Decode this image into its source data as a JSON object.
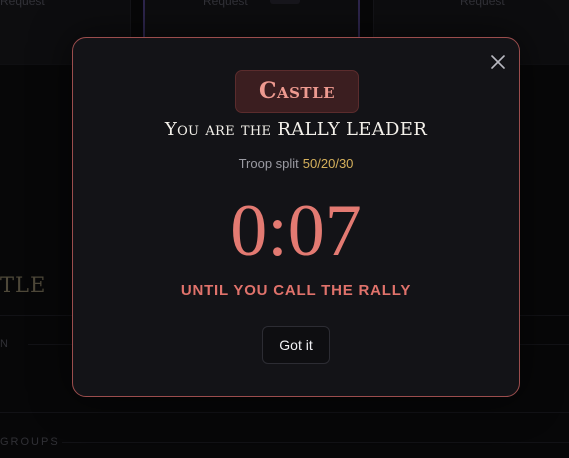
{
  "background": {
    "card_captions": [
      "Request",
      "Request",
      "Request"
    ],
    "section_title": "CASTLE",
    "section_title_visible": "TLE",
    "label_one": "N",
    "label_two": "GROUPS"
  },
  "modal": {
    "badge": "Castle",
    "headline": "You are the RALLY LEADER",
    "split_label": "Troop split",
    "split_value": "50/20/30",
    "timer": "0:07",
    "until_text": "UNTIL YOU CALL THE RALLY",
    "button_label": "Got it",
    "close_icon": "close-icon"
  },
  "colors": {
    "accent": "#e37a72",
    "badge_bg": "#3b1e20",
    "split_value": "#d6b15c",
    "border": "#9b4d4d"
  }
}
